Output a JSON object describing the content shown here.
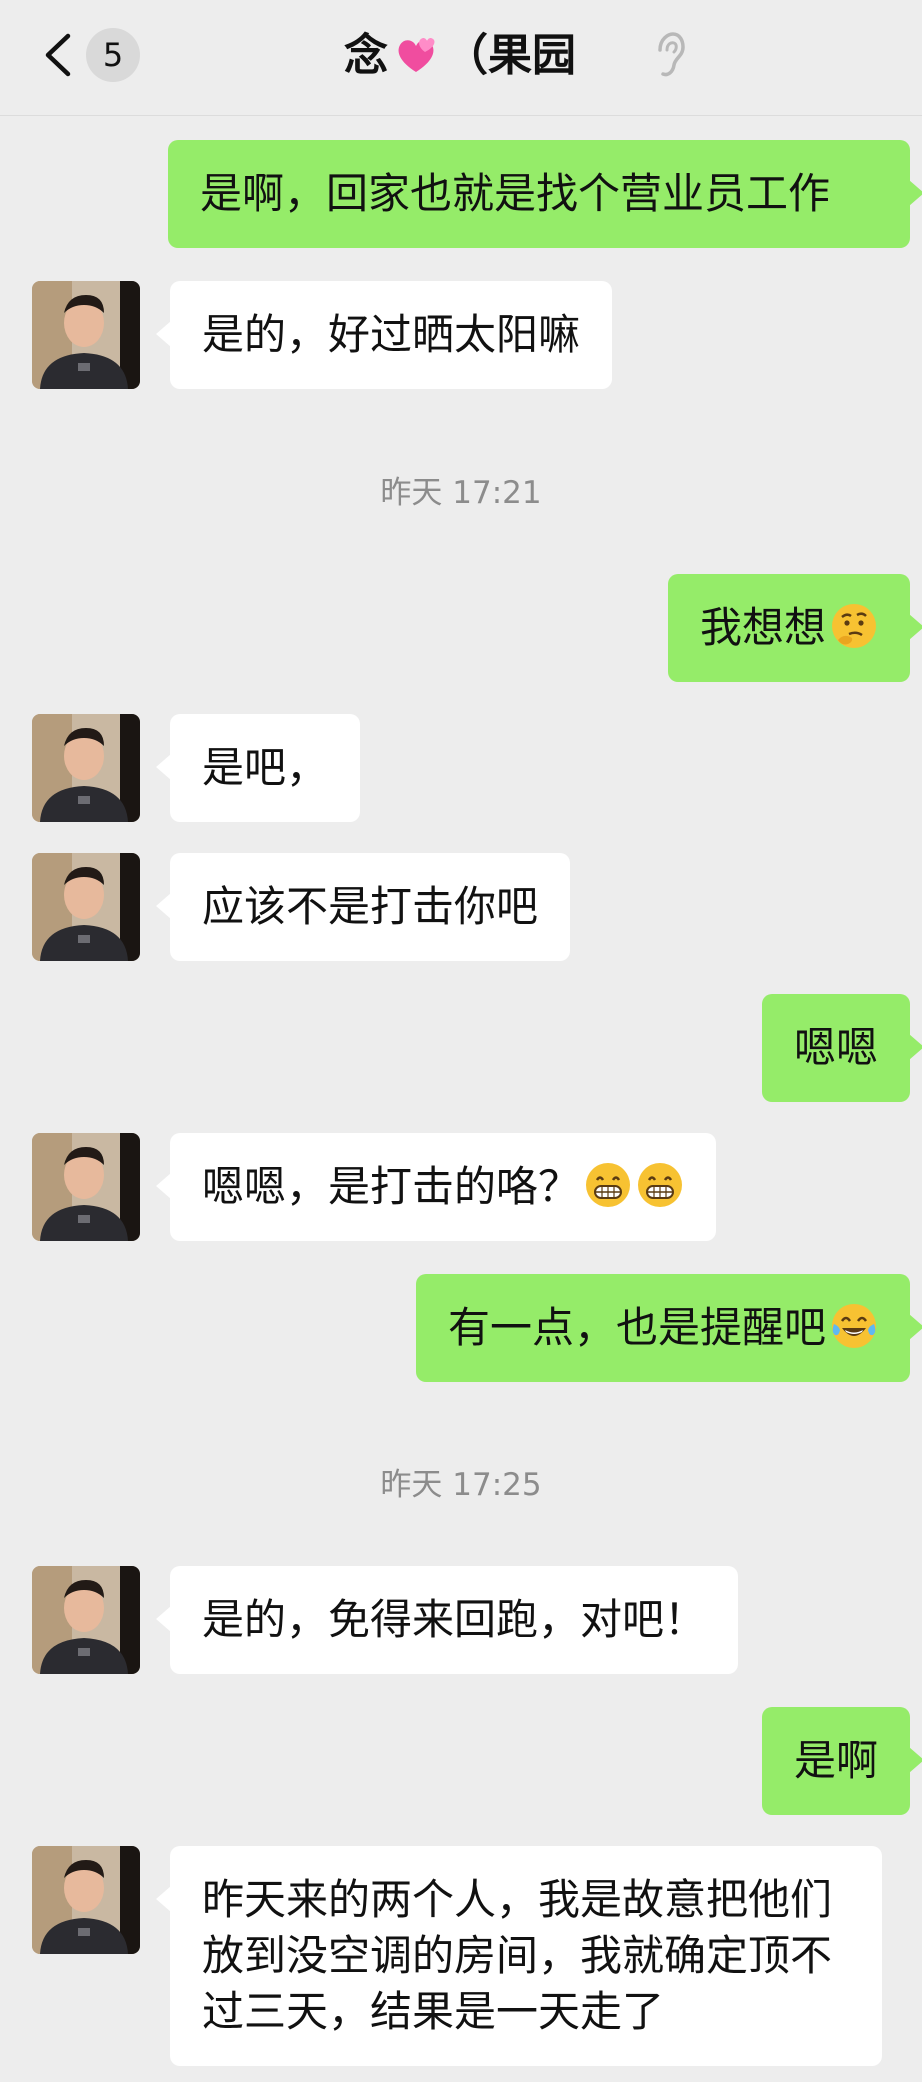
{
  "header": {
    "unread_count": "5",
    "title_prefix": "念",
    "title_suffix": "（果园",
    "title_emoji_icon": "two-hearts-icon",
    "back_icon": "chevron-left-icon",
    "voice_icon": "ear-icon"
  },
  "colors": {
    "background": "#ededed",
    "outgoing_bubble": "#95ec69",
    "incoming_bubble": "#ffffff",
    "timestamp_text": "#8c8c8c"
  },
  "timestamps": [
    "昨天 17:21",
    "昨天 17:25"
  ],
  "messages": [
    {
      "side": "out",
      "text": "是啊，回家也就是找个营业员工作"
    },
    {
      "side": "in",
      "text": "是的，好过晒太阳嘛"
    },
    {
      "side": "out",
      "text": "我想想",
      "emoji": [
        "thinking-face-icon"
      ]
    },
    {
      "side": "in",
      "text": "是吧，"
    },
    {
      "side": "in",
      "text": "应该不是打击你吧"
    },
    {
      "side": "out",
      "text": "嗯嗯"
    },
    {
      "side": "in",
      "text": "嗯嗯，是打击的咯？",
      "emoji": [
        "grinning-face-icon",
        "grinning-face-icon"
      ]
    },
    {
      "side": "out",
      "text": "有一点，也是提醒吧",
      "emoji": [
        "tears-of-joy-icon"
      ]
    },
    {
      "side": "in",
      "text": "是的，免得来回跑，对吧！"
    },
    {
      "side": "out",
      "text": "是啊"
    },
    {
      "side": "in",
      "text": "昨天来的两个人，我是故意把他们放到没空调的房间，我就确定顶不过三天，结果是一天走了"
    }
  ]
}
